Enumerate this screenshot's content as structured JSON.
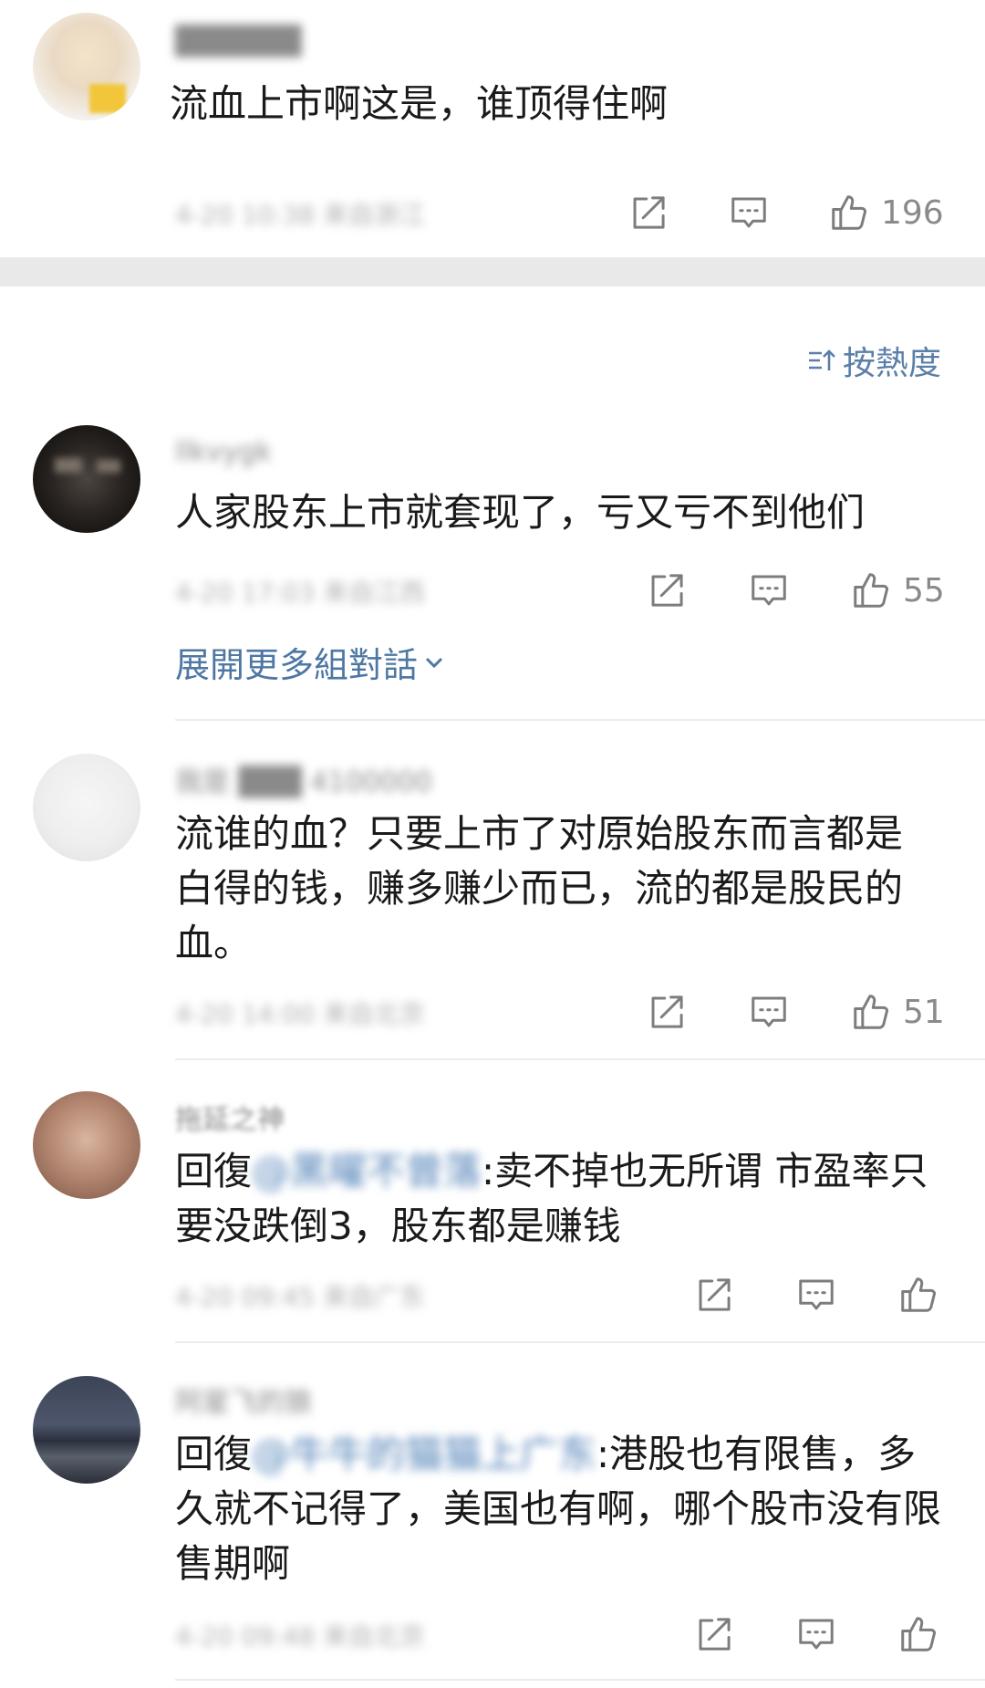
{
  "sort_label": "按熱度",
  "expand_label": "展開更多組對話",
  "comments": [
    {
      "username": "██████",
      "text": "流血上市啊这是，谁顶得住啊",
      "meta": "4-20 10:38 来自浙江",
      "likes": "196"
    },
    {
      "username": "llkvygk",
      "text": "人家股东上市就套现了，亏又亏不到他们",
      "meta": "4-20 17:03 来自江西",
      "likes": "55"
    },
    {
      "username": "我是 ███ 4100000",
      "text": "流谁的血？只要上市了对原始股东而言都是白得的钱，赚多赚少而已，流的都是股民的血。",
      "meta": "4-20 14:00 来自北京",
      "likes": "51"
    },
    {
      "username": "拖延之神",
      "reply_prefix": "回復",
      "mention": "@黑曜不曾落",
      "text": ":卖不掉也无所谓 市盈率只要没跌倒3，股东都是赚钱",
      "meta": "4-20 09:45 来自广东",
      "likes": ""
    },
    {
      "username": "阿星飞的狼",
      "reply_prefix": "回復",
      "mention": "@牛牛的猫猫上广东",
      "text": ":港股也有限售，多久就不记得了，美国也有啊，哪个股市没有限售期啊",
      "meta": "4-20 09:48 来自北京",
      "likes": ""
    }
  ]
}
